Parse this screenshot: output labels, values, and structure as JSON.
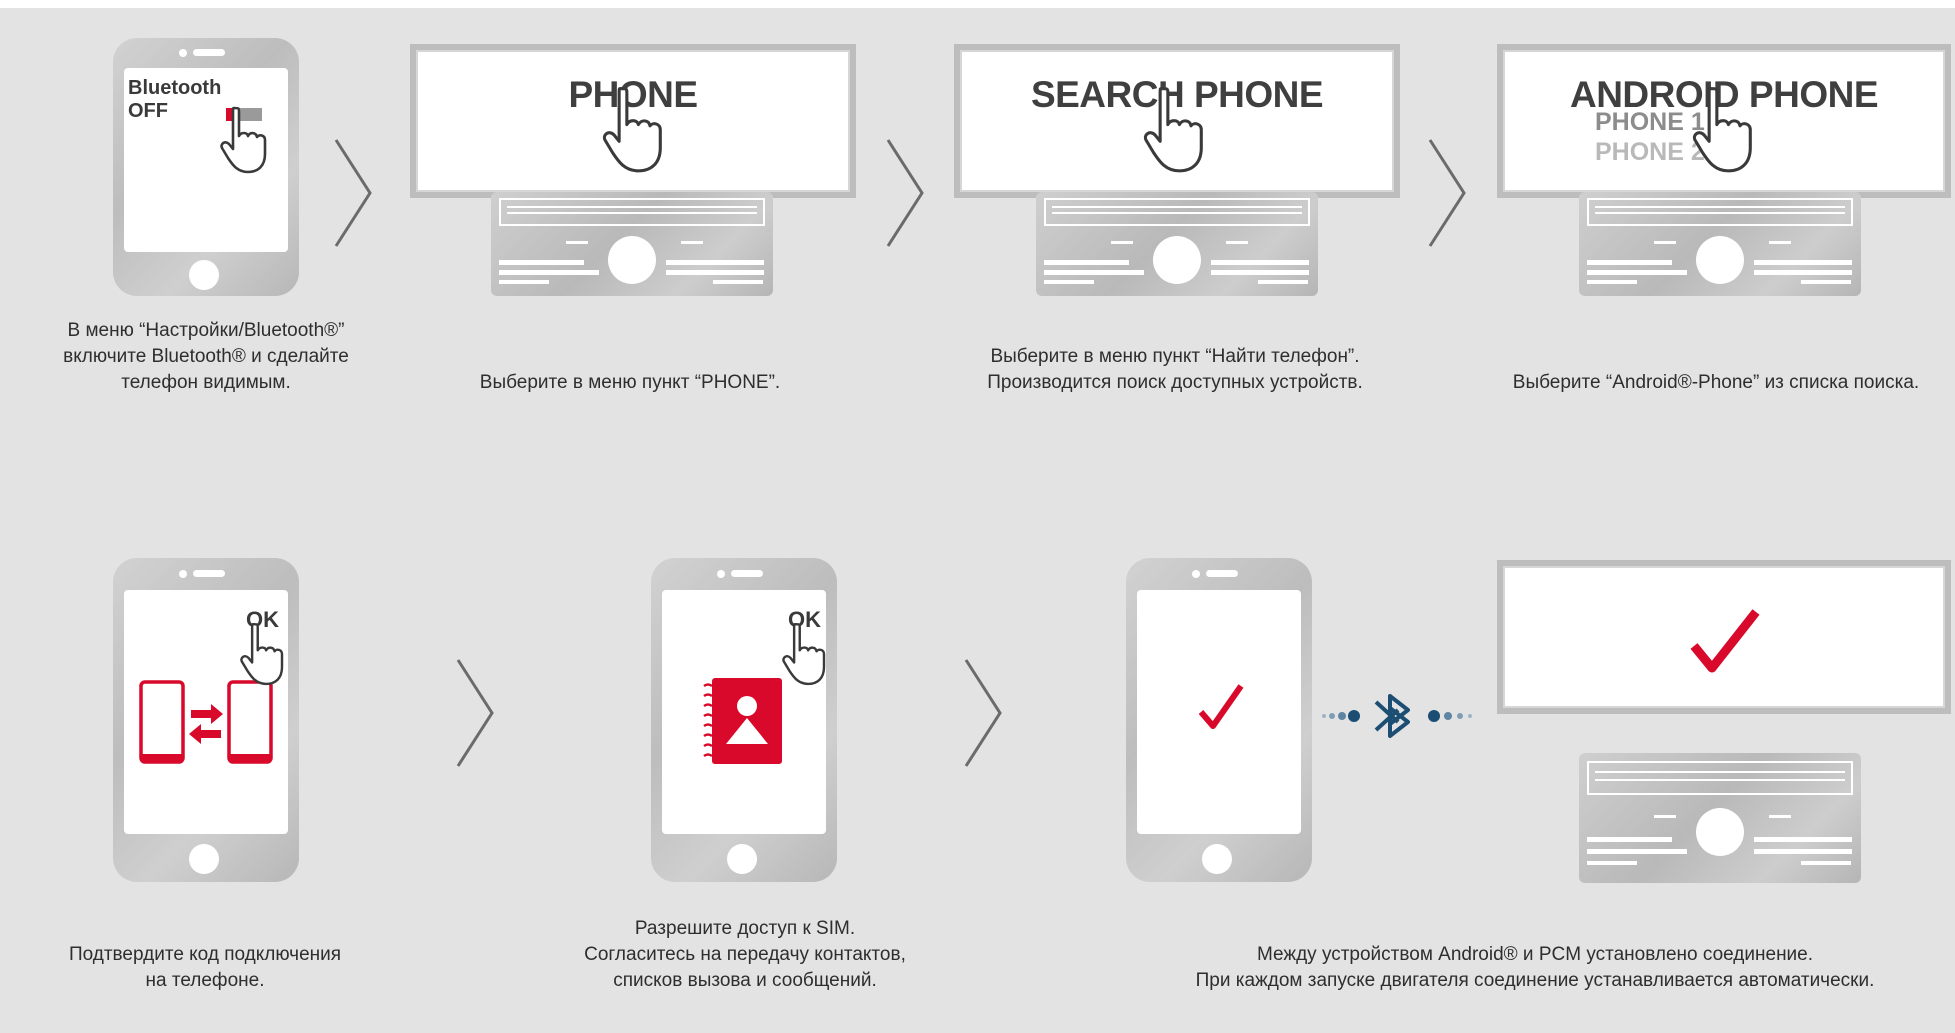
{
  "step1": {
    "phone_label_line1": "Bluetooth",
    "phone_label_line2": "OFF",
    "caption_line1": "В меню “Настройки/Bluetooth®”",
    "caption_line2": "включите Bluetooth® и сделайте",
    "caption_line3": "телефон видимым."
  },
  "step2": {
    "screen_title": "PHONE",
    "caption_line1": "Выберите в меню пункт “PHONE”."
  },
  "step3": {
    "screen_title": "SEARCH PHONE",
    "caption_line1": "Выберите в меню пункт “Найти телефон”.",
    "caption_line2": "Производится поиск доступных устройств."
  },
  "step4": {
    "screen_title": "ANDROID PHONE",
    "list_item1": "PHONE 1",
    "list_item2": "PHONE 2",
    "caption_line1": "Выберите “Android®-Phone” из списка поиска."
  },
  "step5": {
    "ok_label": "OK",
    "caption_line1": "Подтвердите код подключения",
    "caption_line2": "на телефоне."
  },
  "step6": {
    "ok_label": "OK",
    "caption_line1": "Разрешите доступ к SIM.",
    "caption_line2": "Согласитесь на передачу контактов,",
    "caption_line3": "списков вызова и сообщений."
  },
  "step7": {
    "caption_line1": "Между устройством Android® и PCM установлено соединение.",
    "caption_line2": "При каждом запуске двигателя соединение устанавливается автоматически."
  },
  "colors": {
    "accent_red": "#d8092a",
    "bluetooth_blue": "#1b4e72",
    "text_dark": "#3f3f3f",
    "text_light_gray": "#b0b0b0"
  }
}
